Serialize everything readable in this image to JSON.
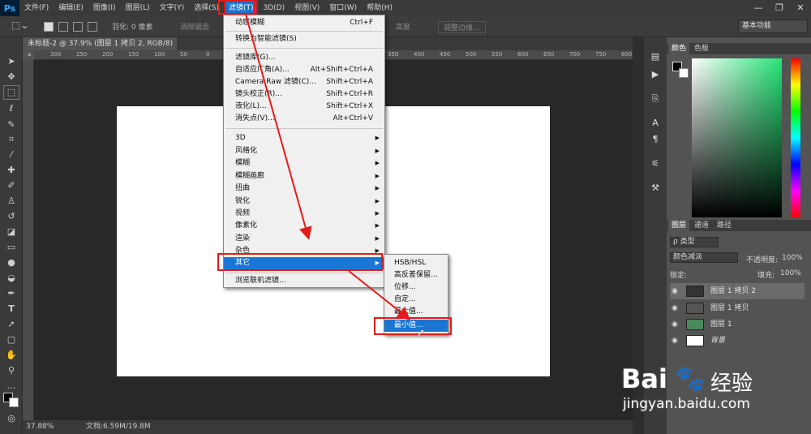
{
  "app": {
    "logo": "Ps"
  },
  "menubar": {
    "items": [
      "文件(F)",
      "编辑(E)",
      "图像(I)",
      "图层(L)",
      "文字(Y)",
      "选择(S)",
      "滤镜(T)",
      "3D(D)",
      "视图(V)",
      "窗口(W)",
      "帮助(H)"
    ],
    "active": "滤镜(T)"
  },
  "window_controls": {
    "minimize": "—",
    "restore": "❐",
    "close": "✕"
  },
  "options": {
    "feather": "羽化: 0 像素",
    "antialias": "消除锯齿",
    "style": "样式: 正常",
    "width": "宽度",
    "height": "高度",
    "refine_edge": "调整边缘...",
    "workspace": "基本功能"
  },
  "document": {
    "tab": "未标题-2 @ 37.9% (图层 1 拷贝 2, RGB/8) *",
    "zoom": "37.88%",
    "doc_size": "文档:6.59M/19.8M"
  },
  "ruler": {
    "ticks": [
      "300",
      "250",
      "200",
      "150",
      "100",
      "50",
      "0",
      "50",
      "100",
      "150",
      "200",
      "250",
      "300",
      "350",
      "400",
      "450",
      "500",
      "550",
      "600",
      "650",
      "700",
      "750",
      "800"
    ]
  },
  "filter_menu": {
    "items": [
      {
        "label": "动感模糊",
        "shortcut": "Ctrl+F"
      },
      {
        "label": "转换为智能滤镜(S)",
        "shortcut": ""
      },
      {
        "label": "滤镜库(G)...",
        "shortcut": ""
      },
      {
        "label": "自适应广角(A)...",
        "shortcut": "Alt+Shift+Ctrl+A"
      },
      {
        "label": "Camera Raw 滤镜(C)...",
        "shortcut": "Shift+Ctrl+A"
      },
      {
        "label": "镜头校正(R)...",
        "shortcut": "Shift+Ctrl+R"
      },
      {
        "label": "液化(L)...",
        "shortcut": "Shift+Ctrl+X"
      },
      {
        "label": "消失点(V)...",
        "shortcut": "Alt+Ctrl+V"
      },
      {
        "label": "3D",
        "shortcut": ""
      },
      {
        "label": "风格化",
        "shortcut": ""
      },
      {
        "label": "模糊",
        "shortcut": ""
      },
      {
        "label": "模糊画廊",
        "shortcut": ""
      },
      {
        "label": "扭曲",
        "shortcut": ""
      },
      {
        "label": "锐化",
        "shortcut": ""
      },
      {
        "label": "视频",
        "shortcut": ""
      },
      {
        "label": "像素化",
        "shortcut": ""
      },
      {
        "label": "渲染",
        "shortcut": ""
      },
      {
        "label": "杂色",
        "shortcut": ""
      },
      {
        "label": "其它",
        "shortcut": ""
      },
      {
        "label": "浏览联机滤镜...",
        "shortcut": ""
      }
    ]
  },
  "other_submenu": {
    "items": [
      "HSB/HSL",
      "高反差保留...",
      "位移...",
      "自定...",
      "最大值...",
      "最小值..."
    ],
    "highlighted": "最小值..."
  },
  "panels": {
    "color_tabs": [
      "颜色",
      "色板"
    ],
    "layers_tabs": [
      "图层",
      "通道",
      "路径"
    ],
    "kind_filter": "ρ 类型",
    "blend_mode": "颜色减淡",
    "opacity_label": "不透明度:",
    "opacity": "100%",
    "lock_label": "锁定:",
    "fill_label": "填充:",
    "fill": "100%",
    "layers": [
      "图层 1 拷贝 2",
      "图层 1 拷贝",
      "图层 1",
      "背景"
    ]
  },
  "watermark": {
    "brand": "Bai",
    "brand2": "经验",
    "url": "jingyan.baidu.com"
  },
  "colors": {
    "menu_highlight": "#1a76d2",
    "annotation": "#e41b1b"
  }
}
